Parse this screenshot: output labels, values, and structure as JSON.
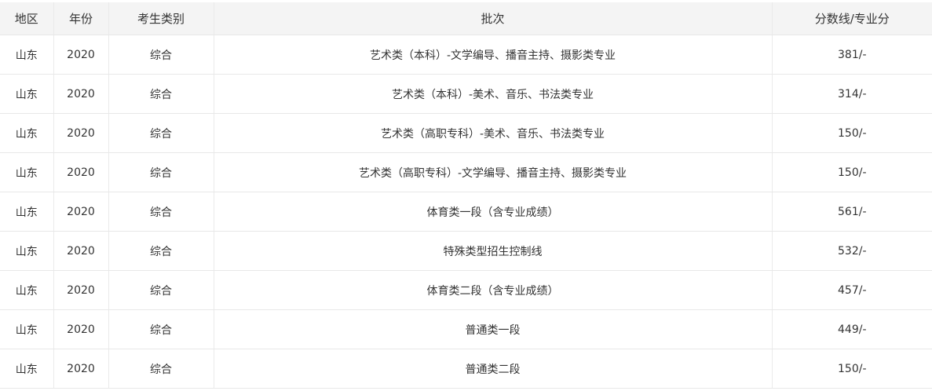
{
  "table": {
    "headers": {
      "region": "地区",
      "year": "年份",
      "category": "考生类别",
      "batch": "批次",
      "score": "分数线/专业分"
    },
    "rows": [
      {
        "region": "山东",
        "year": "2020",
        "category": "综合",
        "batch": "艺术类（本科）-文学编导、播音主持、摄影类专业",
        "score": "381/-"
      },
      {
        "region": "山东",
        "year": "2020",
        "category": "综合",
        "batch": "艺术类（本科）-美术、音乐、书法类专业",
        "score": "314/-"
      },
      {
        "region": "山东",
        "year": "2020",
        "category": "综合",
        "batch": "艺术类（高职专科）-美术、音乐、书法类专业",
        "score": "150/-"
      },
      {
        "region": "山东",
        "year": "2020",
        "category": "综合",
        "batch": "艺术类（高职专科）-文学编导、播音主持、摄影类专业",
        "score": "150/-"
      },
      {
        "region": "山东",
        "year": "2020",
        "category": "综合",
        "batch": "体育类一段（含专业成绩）",
        "score": "561/-"
      },
      {
        "region": "山东",
        "year": "2020",
        "category": "综合",
        "batch": "特殊类型招生控制线",
        "score": "532/-"
      },
      {
        "region": "山东",
        "year": "2020",
        "category": "综合",
        "batch": "体育类二段（含专业成绩）",
        "score": "457/-"
      },
      {
        "region": "山东",
        "year": "2020",
        "category": "综合",
        "batch": "普通类一段",
        "score": "449/-"
      },
      {
        "region": "山东",
        "year": "2020",
        "category": "综合",
        "batch": "普通类二段",
        "score": "150/-"
      }
    ]
  }
}
